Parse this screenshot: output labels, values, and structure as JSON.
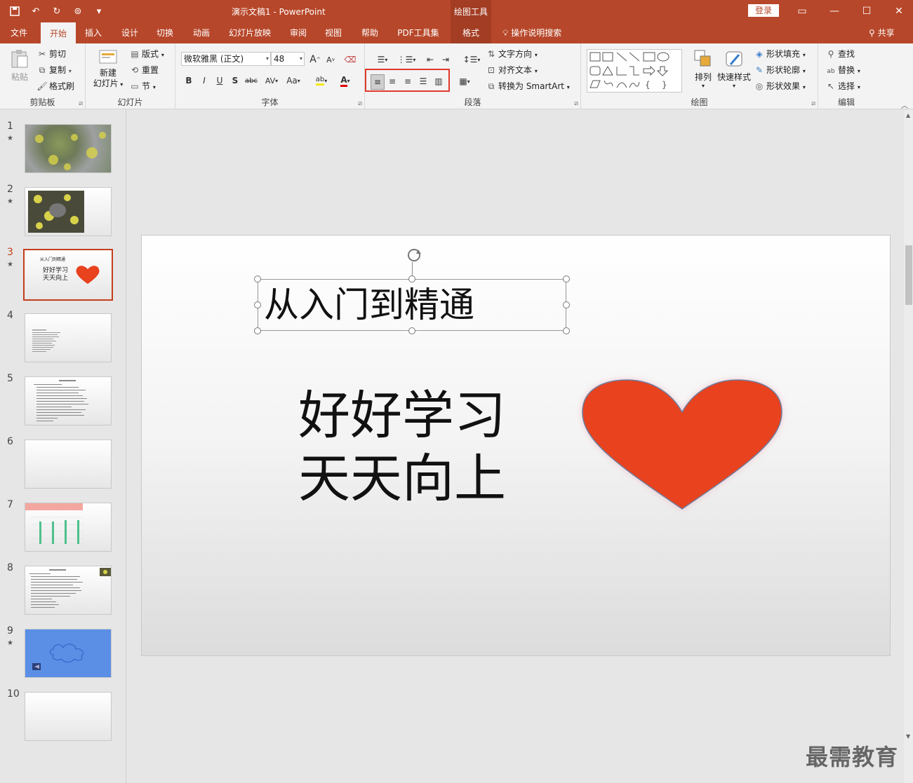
{
  "window": {
    "doc_title": "演示文稿1  -  PowerPoint",
    "context_tab_group": "绘图工具",
    "login_label": "登录"
  },
  "tabs": [
    "文件",
    "开始",
    "插入",
    "设计",
    "切换",
    "动画",
    "幻灯片放映",
    "审阅",
    "视图",
    "帮助",
    "PDF工具集",
    "格式"
  ],
  "active_tab": "开始",
  "tellme_label": "操作说明搜索",
  "share_label": "共享",
  "ribbon": {
    "clipboard": {
      "label": "剪贴板",
      "paste": "粘贴",
      "cut": "剪切",
      "copy": "复制",
      "format_painter": "格式刷"
    },
    "slides": {
      "label": "幻灯片",
      "new_slide_line1": "新建",
      "new_slide_line2": "幻灯片",
      "layout": "版式",
      "reset": "重置",
      "section": "节"
    },
    "font": {
      "label": "字体",
      "font_name": "微软雅黑 (正文)",
      "font_size": "48",
      "grow": "A",
      "shrink": "A",
      "bold": "B",
      "italic": "I",
      "underline": "U",
      "shadow": "S",
      "strike": "abc",
      "spacing": "AV",
      "case": "Aa"
    },
    "paragraph": {
      "label": "段落",
      "text_direction": "文字方向",
      "align_text": "对齐文本",
      "smartart": "转换为 SmartArt"
    },
    "drawing": {
      "label": "绘图",
      "arrange": "排列",
      "quick_styles": "快速样式",
      "shape_fill": "形状填充",
      "shape_outline": "形状轮廓",
      "shape_effects": "形状效果"
    },
    "editing": {
      "label": "编辑",
      "find": "查找",
      "replace": "替换",
      "select": "选择"
    }
  },
  "thumbnails": [
    {
      "num": "1",
      "star": "★"
    },
    {
      "num": "2",
      "star": "★"
    },
    {
      "num": "3",
      "star": "★",
      "title": "从入门到精通",
      "body1": "好好学习",
      "body2": "天天向上"
    },
    {
      "num": "4",
      "star": ""
    },
    {
      "num": "5",
      "star": ""
    },
    {
      "num": "6",
      "star": ""
    },
    {
      "num": "7",
      "star": ""
    },
    {
      "num": "8",
      "star": ""
    },
    {
      "num": "9",
      "star": "★"
    },
    {
      "num": "10",
      "star": ""
    }
  ],
  "slide": {
    "title": "从入门到精通",
    "body_line1": "好好学习",
    "body_line2": "天天向上",
    "heart_color": "#e8421f"
  },
  "watermark": "最需教育"
}
